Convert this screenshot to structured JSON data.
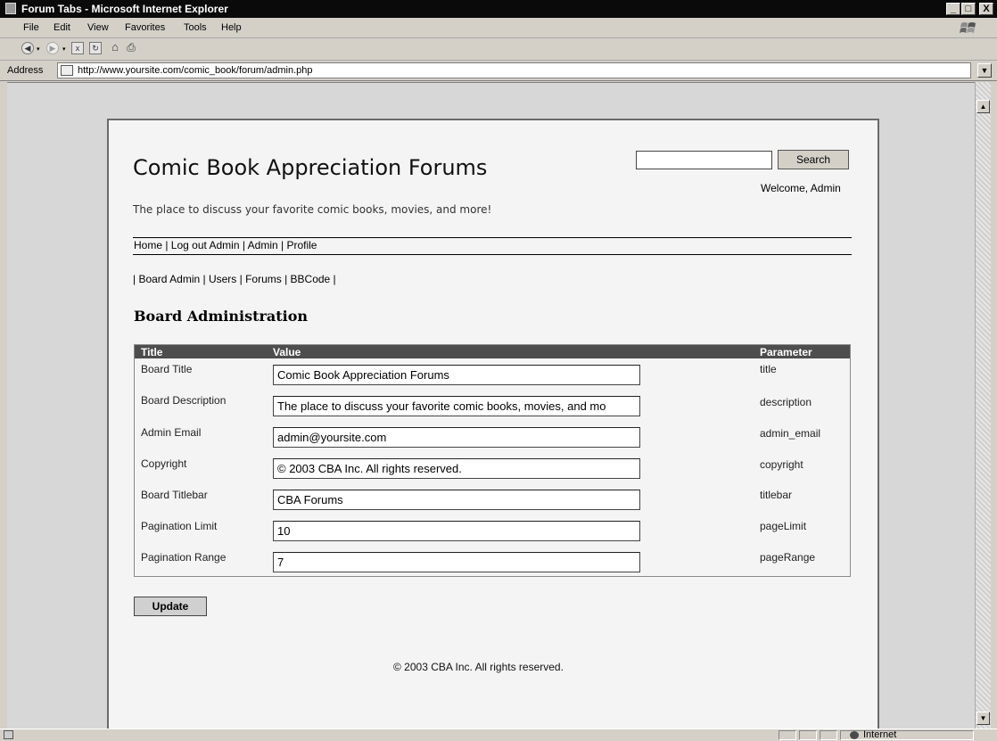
{
  "window": {
    "title": "Forum Tabs - Microsoft Internet Explorer",
    "buttons": {
      "minimize": "_",
      "maximize": "□",
      "close": "X"
    }
  },
  "menu": [
    "File",
    "Edit",
    "View",
    "Favorites",
    "Tools",
    "Help"
  ],
  "toolbar": {
    "back": "◀",
    "forward": "▶",
    "stop": "x",
    "refresh": "↻",
    "home": "⌂",
    "print": "⎙"
  },
  "address": {
    "label": "Address",
    "url": "http://www.yoursite.com/comic_book/forum/admin.php"
  },
  "scroll": {
    "up": "▲",
    "down": "▼"
  },
  "page": {
    "site_title": "Comic Book Appreciation Forums",
    "tagline": "The place to discuss your favorite comic books, movies, and more!",
    "search": {
      "value": "",
      "button": "Search"
    },
    "welcome": "Welcome, Admin",
    "nav": "Home | Log out Admin | Admin | Profile",
    "subnav": "| Board Admin | Users | Forums | BBCode |",
    "section_title": "Board Administration",
    "table": {
      "headers": {
        "title": "Title",
        "value": "Value",
        "parameter": "Parameter"
      },
      "rows": [
        {
          "title": "Board Title",
          "value": "Comic Book Appreciation Forums",
          "param": "title"
        },
        {
          "title": "Board Description",
          "value": "The place to discuss your favorite comic books, movies, and mo",
          "param": "description"
        },
        {
          "title": "Admin Email",
          "value": "admin@yoursite.com",
          "param": "admin_email"
        },
        {
          "title": "Copyright",
          "value": "© 2003 CBA Inc.  All rights reserved.",
          "param": "copyright"
        },
        {
          "title": "Board Titlebar",
          "value": "CBA Forums",
          "param": "titlebar"
        },
        {
          "title": "Pagination Limit",
          "value": "10",
          "param": "pageLimit"
        },
        {
          "title": "Pagination Range",
          "value": "7",
          "param": "pageRange"
        }
      ]
    },
    "update_button": "Update",
    "footer": "© 2003 CBA Inc. All rights reserved."
  },
  "status": {
    "zone": "Internet"
  }
}
